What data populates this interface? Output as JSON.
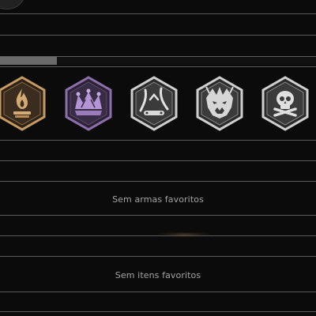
{
  "loadout": {
    "progress_fraction": 0.18,
    "badges": [
      {
        "name": "fire-badge",
        "tier": "bronze",
        "icon": "flame-icon"
      },
      {
        "name": "crown-badge",
        "tier": "purple",
        "icon": "crown-icon"
      },
      {
        "name": "claw-badge",
        "tier": "silver",
        "icon": "claw-marks-icon"
      },
      {
        "name": "beast-badge",
        "tier": "silver",
        "icon": "beast-head-icon"
      },
      {
        "name": "skull-badge",
        "tier": "silver",
        "icon": "skull-crossbones-icon"
      }
    ],
    "favorite_weapons": {
      "empty_text": "Sem armas favoritos"
    },
    "favorite_items": {
      "empty_text": "Sem itens favoritos"
    }
  },
  "colors": {
    "background": "#0b0b0b",
    "divider": "#5d5d5d",
    "progress_fill": "#6a6a6a",
    "bronze": "#c79a62",
    "purple": "#a889c8",
    "silver": "#d4d4d4"
  }
}
